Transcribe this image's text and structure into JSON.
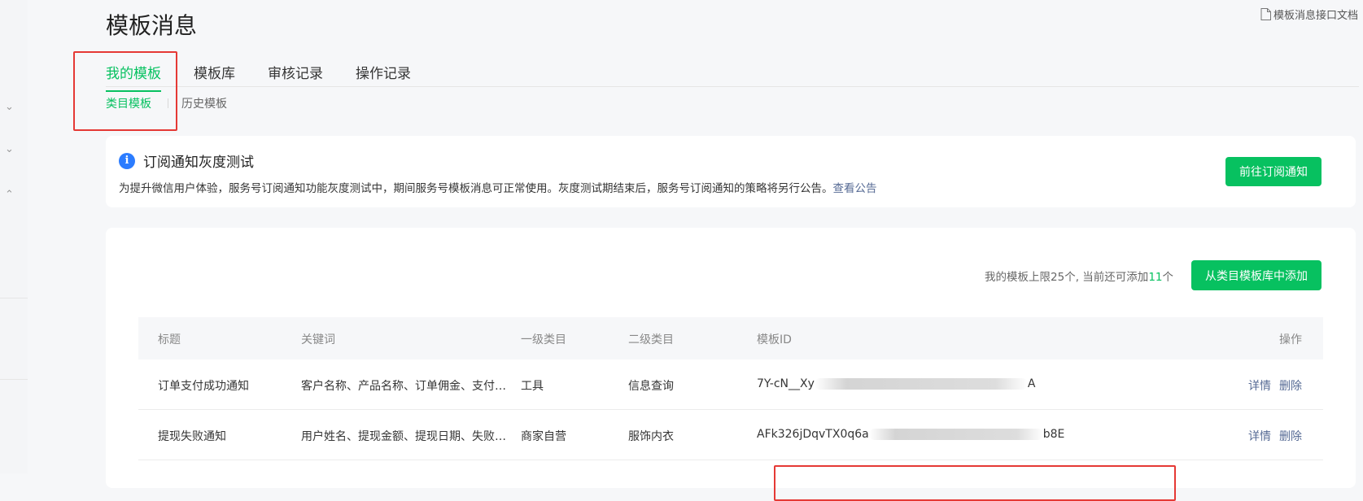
{
  "page_title": "模板消息",
  "doc_link": {
    "label": "模板消息接口文档",
    "icon": "document-icon"
  },
  "tabs": [
    {
      "label": "我的模板",
      "active": true
    },
    {
      "label": "模板库",
      "active": false
    },
    {
      "label": "审核记录",
      "active": false
    },
    {
      "label": "操作记录",
      "active": false
    }
  ],
  "subtabs": [
    {
      "label": "类目模板",
      "active": true
    },
    {
      "label": "历史模板",
      "active": false
    }
  ],
  "notice": {
    "icon": "info-icon",
    "icon_glyph": "i",
    "title": "订阅通知灰度测试",
    "body": "为提升微信用户体验，服务号订阅通知功能灰度测试中，期间服务号模板消息可正常使用。灰度测试期结束后，服务号订阅通知的策略将另行公告。",
    "link": "查看公告",
    "button": "前往订阅通知"
  },
  "quota": {
    "prefix": "我的模板上限25个, 当前还可添加",
    "count": "11",
    "suffix": "个"
  },
  "add_button": "从类目模板库中添加",
  "table": {
    "headers": [
      "标题",
      "关键词",
      "一级类目",
      "二级类目",
      "模板ID",
      "操作"
    ],
    "rows": [
      {
        "title": "订单支付成功通知",
        "keywords": "客户名称、产品名称、订单佣金、支付…",
        "category1": "工具",
        "category2": "信息查询",
        "template_id_start": "7Y-cN__Xy",
        "template_id_end": "A",
        "ops": [
          "详情",
          "删除"
        ]
      },
      {
        "title": "提现失败通知",
        "keywords": "用户姓名、提现金额、提现日期、失败…",
        "category1": "商家自营",
        "category2": "服饰内衣",
        "template_id_start": "AFk326jDqvTX0q6a",
        "template_id_end": "b8E",
        "ops": [
          "详情",
          "删除"
        ]
      }
    ]
  },
  "colors": {
    "accent": "#07c160",
    "link": "#576b95",
    "highlight": "#e53935",
    "info": "#2b7cff"
  }
}
